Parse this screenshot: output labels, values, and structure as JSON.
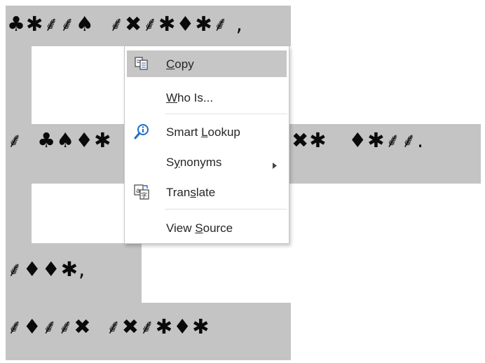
{
  "document": {
    "lines": [
      {
        "text": "♣✱⸙⸙♠  ⸙✖⸙✱♦✱⸙ ,"
      },
      {
        "text": "⸙  ♣♠♦✱"
      },
      {
        "text": "✖✱   ♦✱⸙⸙."
      },
      {
        "text": "⸙♦♦✱,"
      },
      {
        "text": "⸙♦⸙⸙✖  ⸙✖⸙✱♦✱"
      }
    ],
    "selection_color": "#c4c4c4"
  },
  "context_menu": {
    "items": [
      {
        "pre": "",
        "accel": "C",
        "post": "opy",
        "icon": "copy-icon",
        "highlighted": true
      },
      {
        "pre": "",
        "accel": "W",
        "post": "ho Is...",
        "icon": ""
      },
      {
        "pre": "Smart ",
        "accel": "L",
        "post": "ookup",
        "icon": "smart-lookup-icon"
      },
      {
        "pre": "S",
        "accel": "y",
        "post": "nonyms",
        "icon": "",
        "has_submenu": true
      },
      {
        "pre": "Tran",
        "accel": "s",
        "post": "late",
        "icon": "translate-icon"
      },
      {
        "pre": "View ",
        "accel": "S",
        "post": "ource",
        "icon": ""
      }
    ],
    "hover_color": "#c6c6c6",
    "icon_accent": "#1e6ec8"
  }
}
